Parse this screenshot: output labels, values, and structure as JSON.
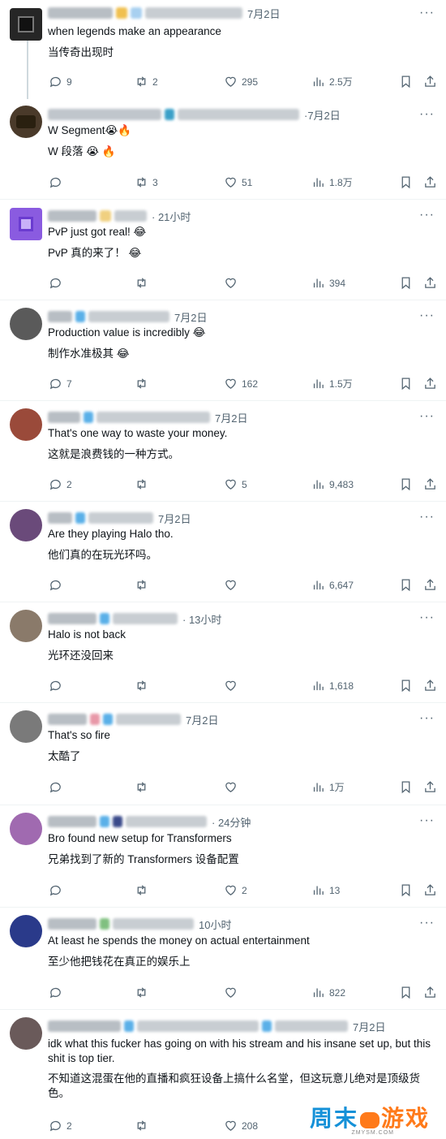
{
  "posts": [
    {
      "time": "7月2日",
      "en": "when legends make an appearance",
      "zh": "当传奇出现时",
      "replies": "9",
      "reposts": "2",
      "likes": "295",
      "views": "2.5万",
      "avatar": "#262626"
    },
    {
      "time": "·7月2日",
      "en": "W Segment😭🔥",
      "zh": "W 段落 😭 🔥",
      "replies": "",
      "reposts": "3",
      "likes": "51",
      "views": "1.8万",
      "avatar": "#4a3a2a"
    },
    {
      "time": "· 21小时",
      "en": "PvP just got real! 😂",
      "zh": "PvP 真的来了！ 😂",
      "replies": "",
      "reposts": "",
      "likes": "",
      "views": "394",
      "avatar": "#8a5be0"
    },
    {
      "time": "7月2日",
      "en": "Production value is incredibly 😂",
      "zh": "制作水准极其 😂",
      "replies": "7",
      "reposts": "",
      "likes": "162",
      "views": "1.5万",
      "avatar": "#5a5a5a"
    },
    {
      "time": "7月2日",
      "en": "That's one way to waste your money.",
      "zh": "这就是浪费钱的一种方式。",
      "replies": "2",
      "reposts": "",
      "likes": "5",
      "views": "9,483",
      "avatar": "#9a4a3a"
    },
    {
      "time": "7月2日",
      "en": "Are they playing Halo tho.",
      "zh": "他们真的在玩光环吗。",
      "replies": "",
      "reposts": "",
      "likes": "",
      "views": "6,647",
      "avatar": "#6a4a7a"
    },
    {
      "time": "· 13小时",
      "en": "Halo is not back",
      "zh": "光环还没回来",
      "replies": "",
      "reposts": "",
      "likes": "",
      "views": "1,618",
      "avatar": "#8a7a6a"
    },
    {
      "time": "7月2日",
      "en": "That's so fire",
      "zh": "太酷了",
      "replies": "",
      "reposts": "",
      "likes": "",
      "views": "1万",
      "avatar": "#7a7a7a"
    },
    {
      "time": "· 24分钟",
      "en": "Bro found new setup for Transformers",
      "zh": "兄弟找到了新的 Transformers 设备配置",
      "replies": "",
      "reposts": "",
      "likes": "2",
      "views": "13",
      "avatar": "#a06ab0"
    },
    {
      "time": "10小时",
      "en": "At least he spends the money on actual entertainment",
      "zh": "至少他把钱花在真正的娱乐上",
      "replies": "",
      "reposts": "",
      "likes": "",
      "views": "822",
      "avatar": "#2a3a8a"
    },
    {
      "time": "7月2日",
      "en": "idk what this fucker has going on with his stream and his insane set up, but this shit is top tier.",
      "zh": "不知道这混蛋在他的直播和疯狂设备上搞什么名堂，但这玩意儿绝对是顶级货色。",
      "replies": "2",
      "reposts": "",
      "likes": "208",
      "views": "",
      "avatar": "#6a5a5a"
    }
  ],
  "watermark": {
    "brand_a": "周末",
    "brand_b": "游戏",
    "sub": "ZMYSM.COM"
  },
  "more_glyph": "···"
}
